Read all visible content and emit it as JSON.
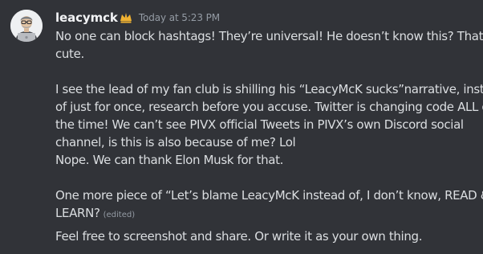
{
  "message": {
    "username": "leacymck",
    "role_icon": "crown-icon",
    "timestamp": "Today at 5:23 PM",
    "lines": [
      "No one can block hashtags! They’re universal! He doesn’t know this? That’s",
      "cute.",
      "",
      "I see the lead of my fan club is shilling his “LeacyMcK sucks”narrative, instead",
      "of just for once, research before you accuse. Twitter is changing code ALL of",
      "the time!  We can’t see PIVX official Tweets in PIVX’s own Discord social",
      "channel, is this is also  because of me? Lol",
      "Nope. We can thank Elon Musk for that.",
      "",
      "One more piece of “Let’s blame LeacyMcK instead of, I don’t know, READ &",
      "LEARN?"
    ],
    "edited_label": "(edited)"
  },
  "followup": {
    "text": "Feel free to screenshot and share. Or write it as your own thing."
  },
  "colors": {
    "background": "#313338",
    "text": "#dbdee1",
    "username": "#f2f3f5",
    "muted": "#949ba4",
    "role_icon": "#f0b232"
  }
}
